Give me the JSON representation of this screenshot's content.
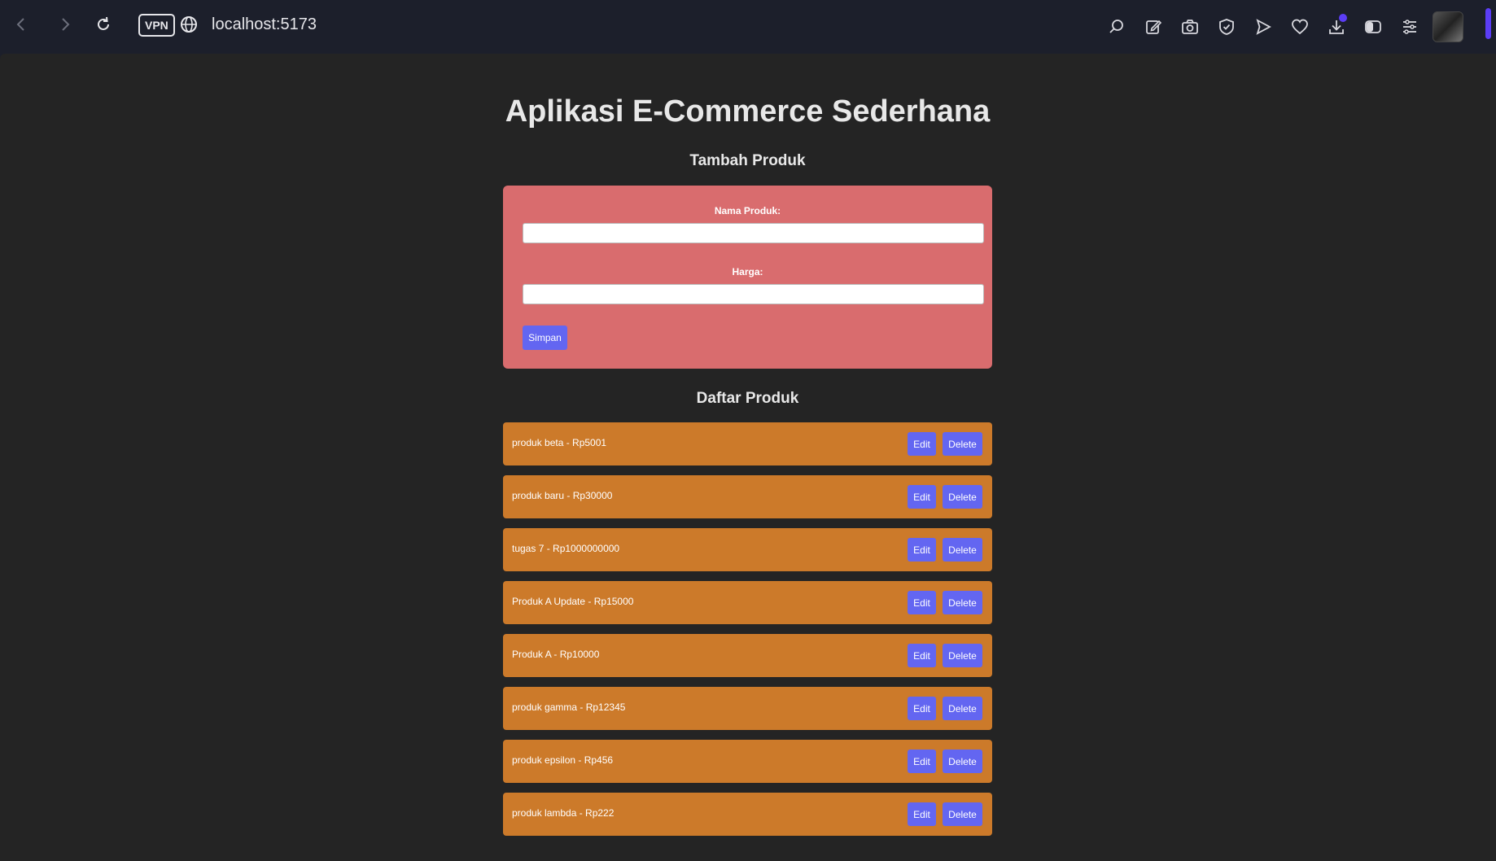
{
  "browser": {
    "vpn_label": "VPN",
    "address": "localhost:5173",
    "accent_color": "#5b3df5",
    "icons": [
      "back-icon",
      "forward-icon",
      "reload-icon",
      "globe-icon",
      "search-page-icon",
      "edit-snapshot-icon",
      "camera-icon",
      "shield-icon",
      "send-icon",
      "heart-icon",
      "download-icon",
      "sidebar-icon",
      "menu-icon"
    ]
  },
  "page": {
    "title": "Aplikasi E-Commerce Sederhana",
    "add_section_title": "Tambah Produk",
    "list_section_title": "Daftar Produk"
  },
  "form": {
    "name_label": "Nama Produk:",
    "name_value": "",
    "price_label": "Harga:",
    "price_value": "",
    "submit_label": "Simpan",
    "card_color": "#d96c6e",
    "button_color": "#6366f1"
  },
  "products": {
    "item_color": "#cc7a2a",
    "edit_label": "Edit",
    "delete_label": "Delete",
    "items": [
      {
        "text": "produk beta - Rp5001"
      },
      {
        "text": "produk baru - Rp30000"
      },
      {
        "text": "tugas 7 - Rp1000000000"
      },
      {
        "text": "Produk A Update - Rp15000"
      },
      {
        "text": "Produk A - Rp10000"
      },
      {
        "text": "produk gamma - Rp12345"
      },
      {
        "text": "produk epsilon - Rp456"
      },
      {
        "text": "produk lambda - Rp222"
      }
    ]
  }
}
